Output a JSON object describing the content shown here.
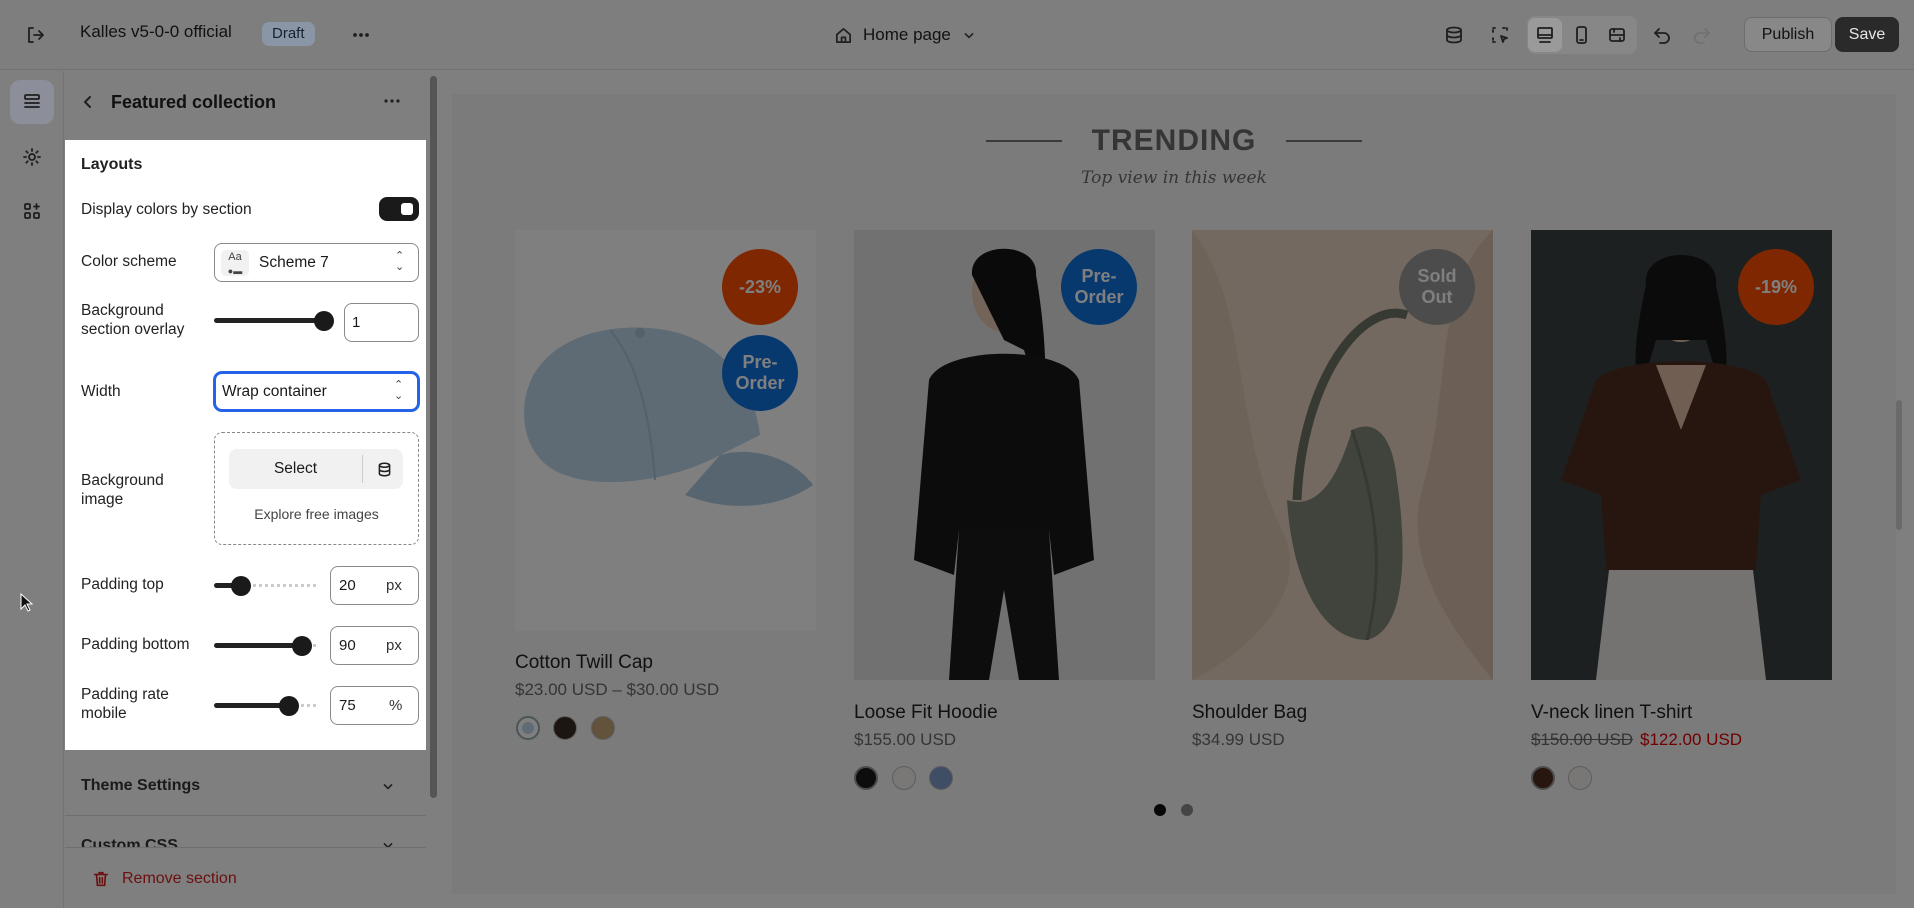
{
  "topbar": {
    "store_name": "Kalles v5-0-0 official",
    "status_badge": "Draft",
    "page_selector": "Home page",
    "publish_label": "Publish",
    "save_label": "Save"
  },
  "sidebar": {
    "section_title": "Featured collection",
    "group_heading": "Layouts",
    "display_colors_label": "Display colors by section",
    "display_colors_on": true,
    "color_scheme_label": "Color scheme",
    "color_scheme_icon_text": "Aa",
    "color_scheme_value": "Scheme 7",
    "overlay_label": "Background section overlay",
    "overlay_value": "1",
    "overlay_fraction": 1,
    "width_label": "Width",
    "width_value": "Wrap container",
    "bg_image_label": "Background image",
    "select_label": "Select",
    "explore_label": "Explore free images",
    "padding_top_label": "Padding top",
    "padding_top_value": "20",
    "padding_top_fraction": 0.23,
    "padding_bottom_label": "Padding bottom",
    "padding_bottom_value": "90",
    "padding_bottom_fraction": 0.9,
    "padding_rate_label": "Padding rate mobile",
    "padding_rate_value": "75",
    "padding_rate_fraction": 0.7,
    "unit_px": "px",
    "unit_percent": "%",
    "theme_settings_label": "Theme Settings",
    "custom_css_label": "Custom CSS",
    "remove_section_label": "Remove section"
  },
  "preview": {
    "heading": "TRENDING",
    "subheading": "Top view in this week",
    "products": [
      {
        "name": "Cotton Twill Cap",
        "price": "$23.00 USD – $30.00 USD",
        "badges": [
          "-23%",
          "Pre-\nOrder"
        ]
      },
      {
        "name": "Loose Fit Hoodie",
        "price": "$155.00 USD",
        "badges": [
          "Pre-\nOrder"
        ]
      },
      {
        "name": "Shoulder Bag",
        "price": "$34.99 USD",
        "badges": [
          "Sold\nOut"
        ]
      },
      {
        "name": "V-neck linen T-shirt",
        "old_price": "$150.00 USD",
        "sale_price": "$122.00 USD",
        "badges": [
          "-19%"
        ]
      }
    ],
    "active_page": 1,
    "page_count": 2
  },
  "colors": {
    "badge_sale": "#ff4e00",
    "badge_preorder": "#0e72dd",
    "badge_soldout": "#999999",
    "sale_price": "#e30000",
    "danger": "#6b0f0f",
    "overlay": "rgba(0,0,0,0.5)"
  },
  "icons": [
    "exit-icon",
    "more-icon",
    "home-icon",
    "chevron-down-icon",
    "storage-icon",
    "inspect-icon",
    "desktop-icon",
    "mobile-icon",
    "fullwidth-icon",
    "undo-icon",
    "redo-icon",
    "sections-icon",
    "gear-icon",
    "apps-icon",
    "back-arrow-icon",
    "database-icon",
    "trash-icon",
    "cursor-icon"
  ]
}
